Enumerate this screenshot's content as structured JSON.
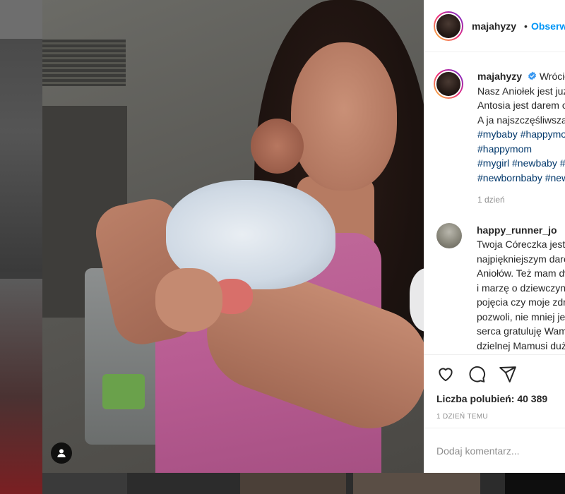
{
  "post": {
    "username": "majahyzy",
    "follow_label": "Obserwuj",
    "dot": "•",
    "caption_lines": [
      {
        "text": "Wróciłyśmy do domu!",
        "first": true
      },
      {
        "text": "Nasz Aniołek jest już z nami w domu!"
      },
      {
        "text": "Antosia jest darem od Boga."
      },
      {
        "text": "A ja najszczęśliwszą mamą na świecie"
      }
    ],
    "hashtag_lines": [
      "#mybaby #happymom #love",
      "#happymom",
      "#mygirl #newbaby #mommy",
      "#newbornbaby #newborn"
    ],
    "caption_time": "1 dzień"
  },
  "comments": [
    {
      "username": "happy_runner_jo",
      "lines": [
        "Twoja Córeczka jest przepiękna",
        "najpiękniejszym darem od Boga",
        "Aniołów. Też mam dwóch synów",
        "i marzę o dziewczynce, nie mam",
        "pojęcia czy moje zdrowie mi",
        "pozwoli, nie mniej jednak z całego",
        "serca gratuluję Wam i życzę",
        "dzielnej Mamusi dużo zdrowia"
      ]
    }
  ],
  "likes": {
    "label": "Liczba polubień:",
    "count": "40 389"
  },
  "post_time": "1 DZIEŃ TEMU",
  "add_comment": {
    "placeholder": "Dodaj komentarz..."
  },
  "icons": {
    "like": "heart-icon",
    "comment": "comment-icon",
    "share": "share-icon",
    "verified": "verified-badge-icon",
    "user_tag": "user-icon"
  },
  "colors": {
    "accent": "#0095f6",
    "hashtag": "#00376b",
    "muted": "#8e8e8e",
    "verified": "#3897f0"
  }
}
